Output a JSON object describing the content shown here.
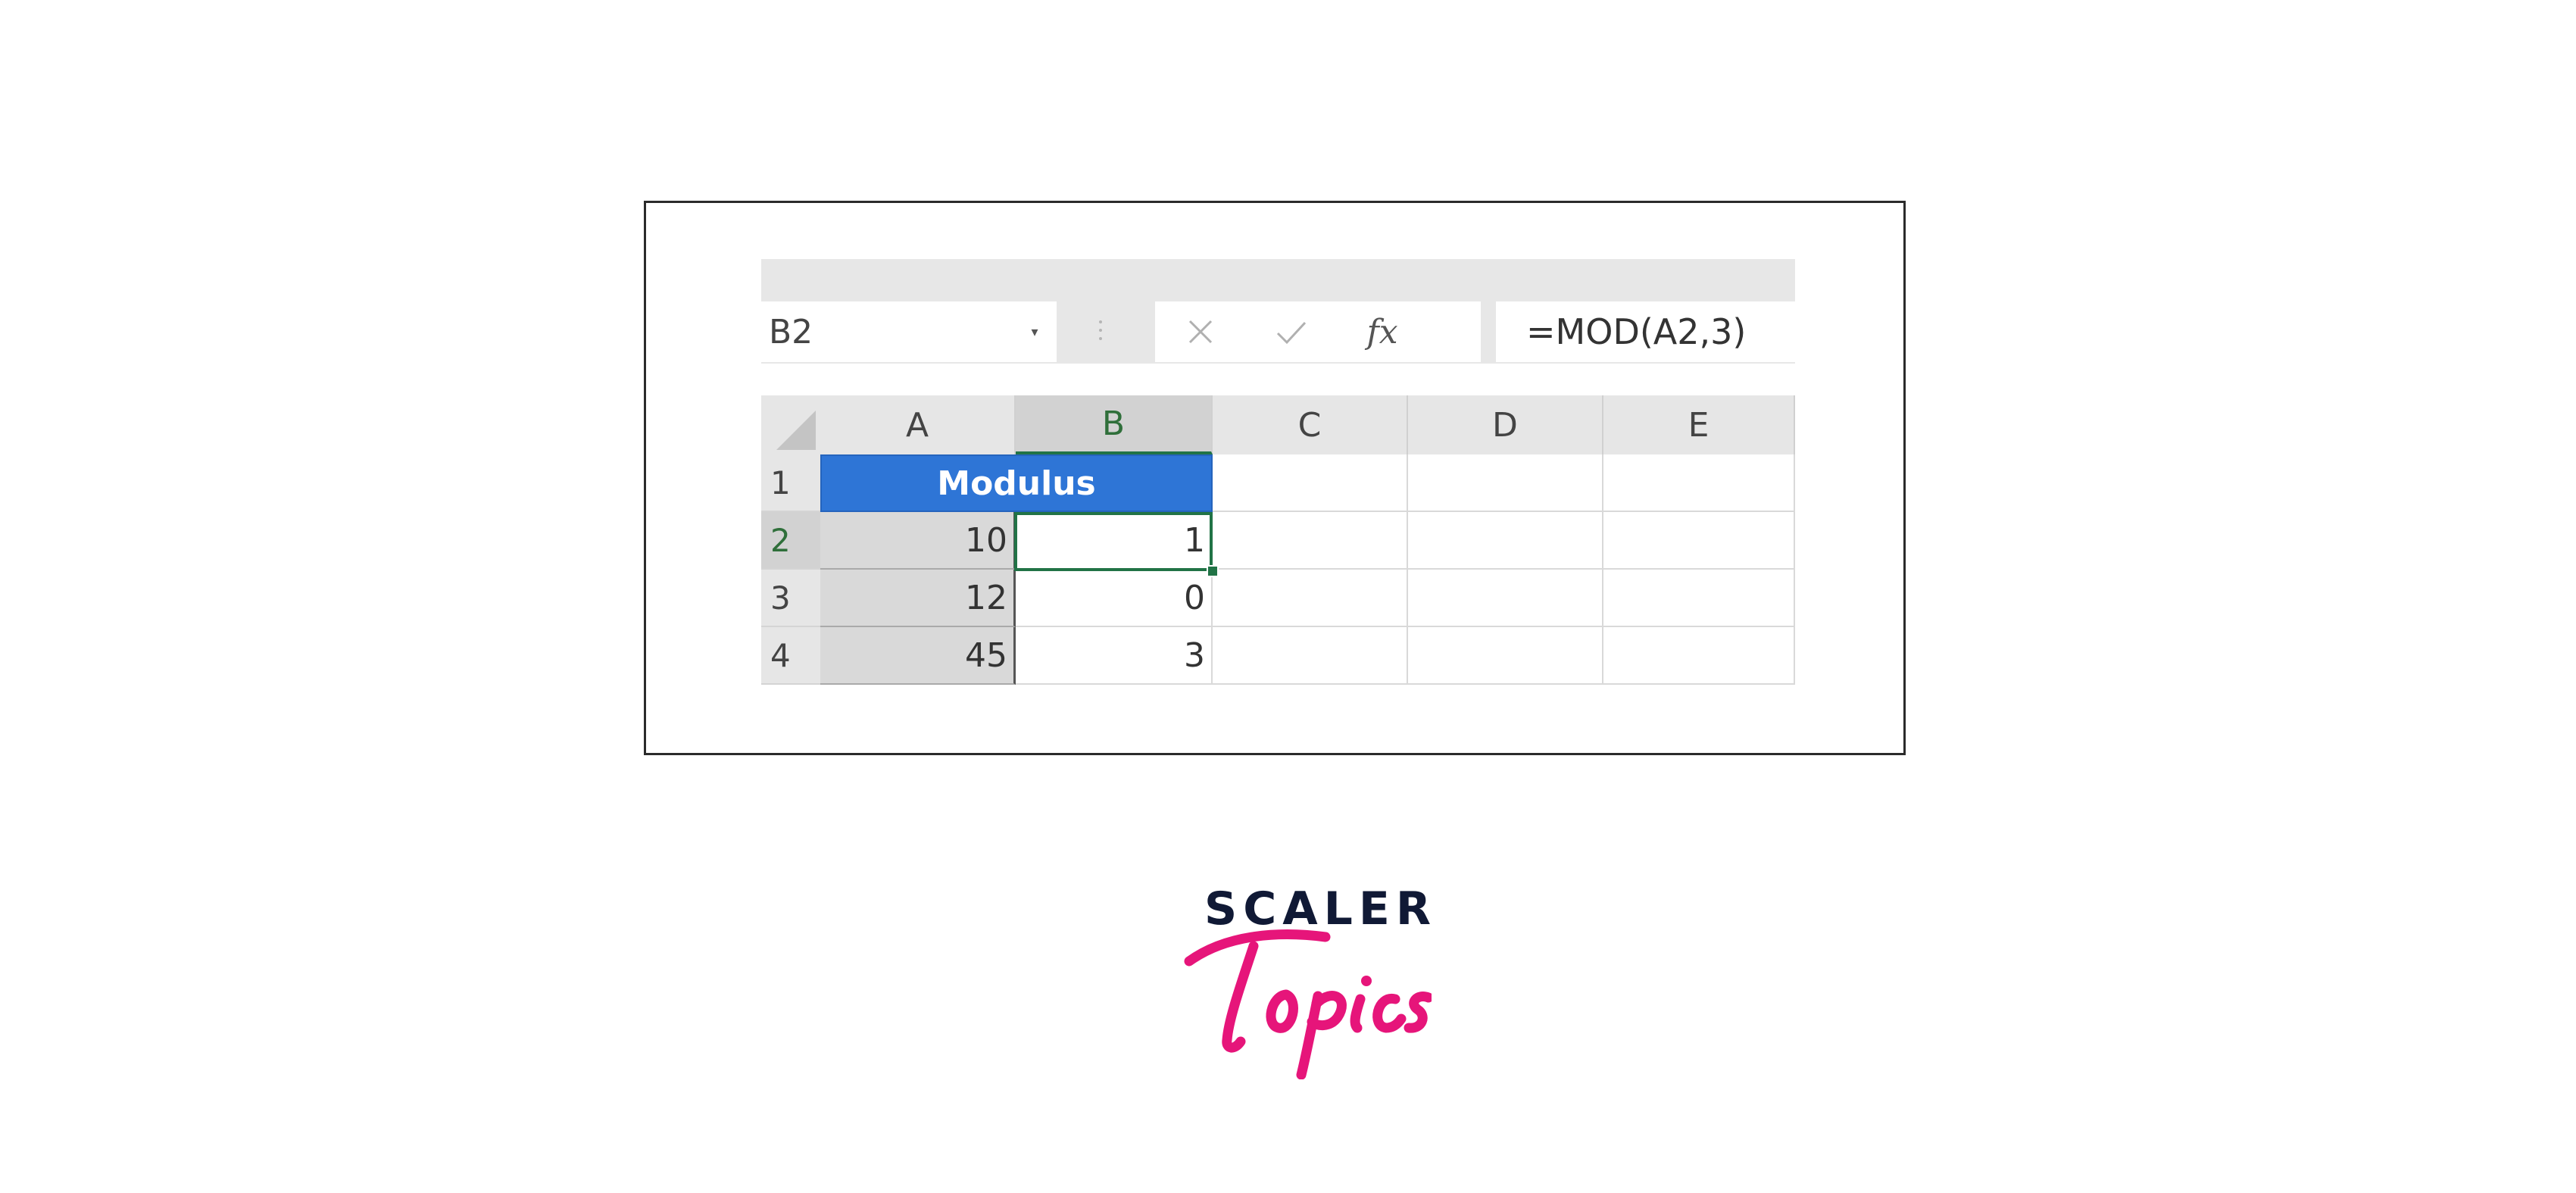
{
  "name_box": {
    "value": "B2"
  },
  "formula_bar": {
    "formula": "=MOD(A2,3)",
    "fx_label": "fx"
  },
  "columns": [
    "A",
    "B",
    "C",
    "D",
    "E"
  ],
  "rows": [
    "1",
    "2",
    "3",
    "4"
  ],
  "table": {
    "header": "Modulus",
    "values": [
      {
        "a": "10",
        "b": "1"
      },
      {
        "a": "12",
        "b": "0"
      },
      {
        "a": "45",
        "b": "3"
      }
    ]
  },
  "logo": {
    "line1": "SCALER",
    "line2": "Topics"
  },
  "colors": {
    "header_fill": "#2e75d6",
    "selection": "#217346",
    "logo_dark": "#101935",
    "logo_pink": "#e6157a"
  },
  "icons": [
    "cancel-icon",
    "enter-check-icon",
    "insert-function-icon",
    "dropdown-caret-icon",
    "select-all-corner-icon"
  ]
}
